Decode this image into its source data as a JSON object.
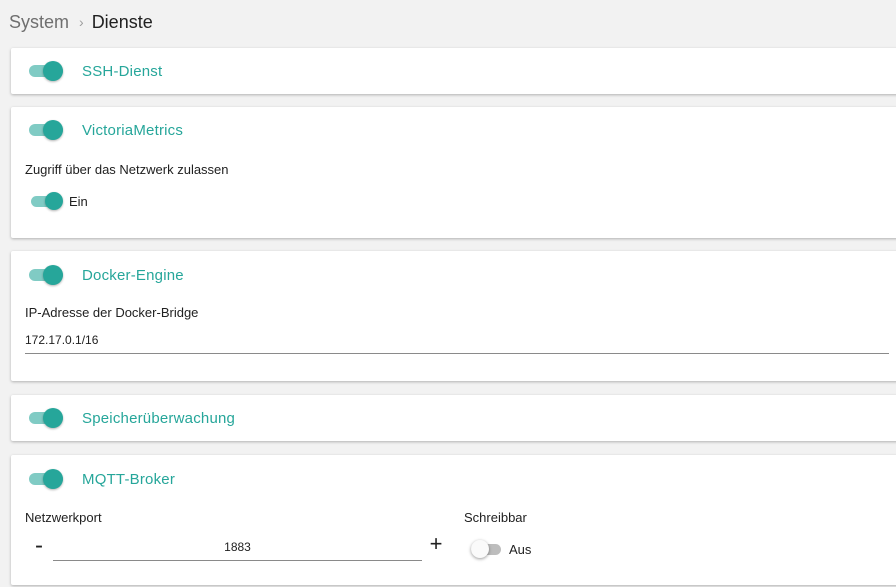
{
  "breadcrumb": {
    "root": "System",
    "separator": "›",
    "current": "Dienste"
  },
  "colors": {
    "accent": "#26a69a",
    "accent_light": "#80cbc4",
    "background": "#f2f2f2"
  },
  "services": {
    "ssh": {
      "title": "SSH-Dienst",
      "enabled": true
    },
    "victoria": {
      "title": "VictoriaMetrics",
      "enabled": true,
      "network_access_label": "Zugriff über das Netzwerk zulassen",
      "network_access_state": "Ein"
    },
    "docker": {
      "title": "Docker-Engine",
      "enabled": true,
      "bridge_label": "IP-Adresse der Docker-Bridge",
      "bridge_value": "172.17.0.1/16"
    },
    "memory": {
      "title": "Speicherüberwachung",
      "enabled": true
    },
    "mqtt": {
      "title": "MQTT-Broker",
      "enabled": true,
      "port_label": "Netzwerkport",
      "port_value": "1883",
      "decrement_symbol": "-",
      "increment_symbol": "+",
      "writable_label": "Schreibbar",
      "writable_state": "Aus"
    }
  }
}
